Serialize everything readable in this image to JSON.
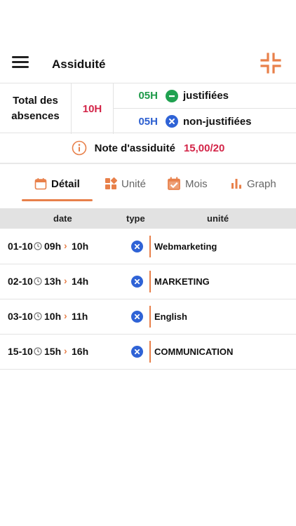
{
  "header": {
    "title": "Assiduité",
    "menu_icon": "hamburger-menu-icon",
    "action_icon": "collapse-arrows-icon",
    "accent_color": "#e8804a"
  },
  "summary": {
    "total_label": "Total des absences",
    "total_value": "10H",
    "justified": {
      "count": "05H",
      "label": "justifiées",
      "icon": "minus-circle-icon",
      "color": "#1f9a4a"
    },
    "unjustified": {
      "count": "05H",
      "label": "non-justifiées",
      "icon": "x-circle-icon",
      "color": "#2c5fd0"
    }
  },
  "note": {
    "label": "Note d'assiduité",
    "value": "15,00/20",
    "icon": "info-circle-icon",
    "value_color": "#d32548"
  },
  "tabs": [
    {
      "label": "Détail",
      "icon": "calendar-icon",
      "active": true
    },
    {
      "label": "Unité",
      "icon": "modules-icon",
      "active": false
    },
    {
      "label": "Mois",
      "icon": "calendar-check-icon",
      "active": false
    },
    {
      "label": "Graph",
      "icon": "bar-chart-icon",
      "active": false
    }
  ],
  "table": {
    "columns": [
      "date",
      "type",
      "unité"
    ],
    "rows": [
      {
        "date": "01-10",
        "start": "09h",
        "end": "10h",
        "type": "non-justifiée",
        "unit": "Webmarketing"
      },
      {
        "date": "02-10",
        "start": "13h",
        "end": "14h",
        "type": "non-justifiée",
        "unit": "MARKETING"
      },
      {
        "date": "03-10",
        "start": "10h",
        "end": "11h",
        "type": "non-justifiée",
        "unit": "English"
      },
      {
        "date": "15-10",
        "start": "15h",
        "end": "16h",
        "type": "non-justifiée",
        "unit": "COMMUNICATION"
      }
    ]
  }
}
